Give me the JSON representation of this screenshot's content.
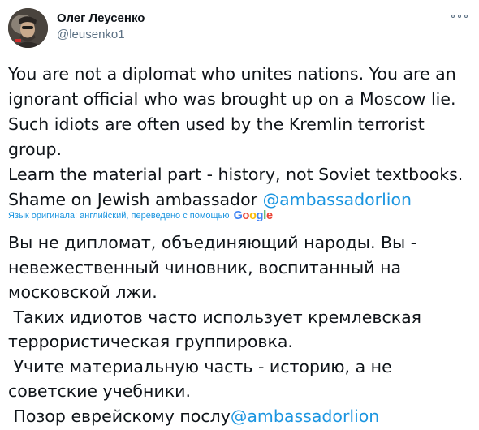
{
  "author": {
    "name": "Олег Леусенко",
    "handle": "@leusenko1",
    "avatar_icon": "user-avatar"
  },
  "more_icon": "more-options-icon",
  "tweet": {
    "original_lines": [
      "You are not a diplomat who unites nations. You are an",
      "ignorant official who was brought up on a Moscow lie.",
      "Such idiots are often used by the Kremlin terrorist",
      "group.",
      "Learn the material part - history, not Soviet textbooks."
    ],
    "original_last_prefix": "Shame on Jewish ambassador ",
    "original_mention": "@ambassadorlion",
    "translation_note": "Язык оригинала: английский, переведено с помощью",
    "translation_service": "Google",
    "translated_lines": [
      "Вы не дипломат, объединяющий народы. Вы -",
      "невежественный чиновник, воспитанный на",
      "московской лжи.",
      " Таких идиотов часто использует кремлевская",
      "террористическая группировка.",
      " Учите материальную часть - историю, а не",
      "советские учебники."
    ],
    "translated_last_prefix": " Позор еврейскому послу",
    "translated_mention": "@ambassadorlion"
  },
  "colors": {
    "text": "#0f1419",
    "secondary": "#5b7083",
    "link": "#1b95e0"
  }
}
